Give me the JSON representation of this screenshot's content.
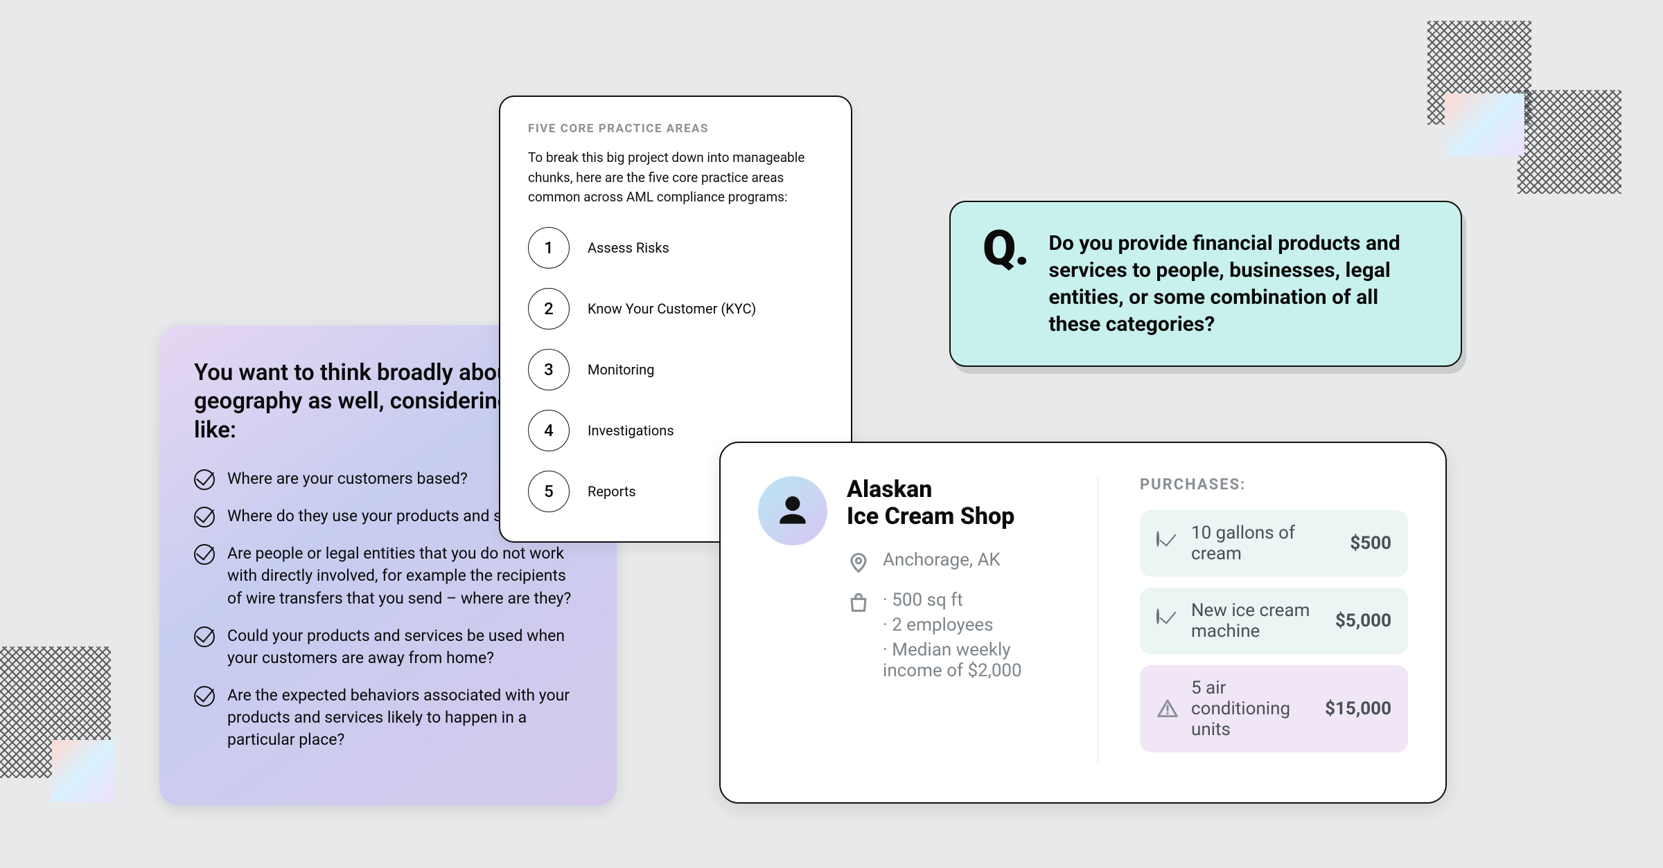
{
  "geo": {
    "heading": "You want to think broadly about geography as well, considering things like:",
    "items": [
      "Where are your customers based?",
      "Where do they use your products and services?",
      "Are people or legal entities that you do not work with directly involved, for example the recipients of wire transfers that you send – where are they?",
      "Could your products and services be used when your customers are away from home?",
      "Are the expected behaviors associated with your products and services likely to happen in a particular place?"
    ]
  },
  "practice": {
    "eyebrow": "FIVE CORE PRACTICE AREAS",
    "intro": "To break this big project down into manageable chunks, here are the five core practice areas common across AML compliance programs:",
    "items": [
      {
        "n": "1",
        "label": "Assess Risks"
      },
      {
        "n": "2",
        "label": "Know Your Customer (KYC)"
      },
      {
        "n": "3",
        "label": "Monitoring"
      },
      {
        "n": "4",
        "label": "Investigations"
      },
      {
        "n": "5",
        "label": "Reports"
      }
    ]
  },
  "question": {
    "letter": "Q.",
    "text": "Do you provide financial products and services to people, businesses, legal entities, or some combination of all these categories?"
  },
  "business": {
    "name_line1": "Alaskan",
    "name_line2": "Ice Cream Shop",
    "location": "Anchorage, AK",
    "facts": [
      "500 sq ft",
      "2 employees",
      "Median weekly income of $2,000"
    ],
    "purchases_label": "PURCHASES:",
    "purchases": [
      {
        "name": "10 gallons of cream",
        "price": "$500",
        "status": "ok"
      },
      {
        "name": "New ice cream machine",
        "price": "$5,000",
        "status": "ok"
      },
      {
        "name": "5 air conditioning units",
        "price": "$15,000",
        "status": "warn"
      }
    ]
  }
}
